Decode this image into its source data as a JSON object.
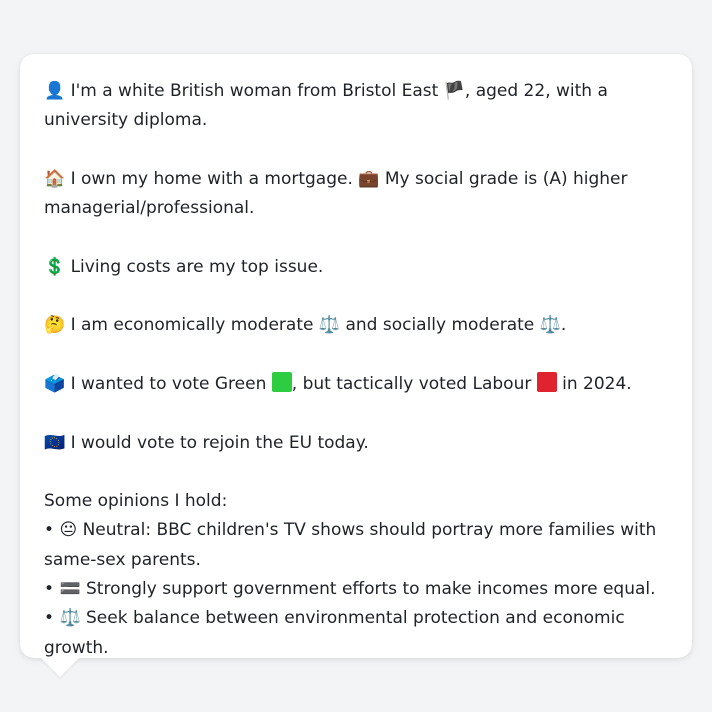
{
  "colors": {
    "background": "#f3f4f6",
    "bubble": "#ffffff",
    "text": "#1f2328",
    "green_square": "#2ecc40",
    "red_square": "#e0242f"
  },
  "persona": {
    "identity": {
      "icon": "👤",
      "text_a": " I'm a white British woman from Bristol East ",
      "flag": "🏴",
      "text_b": ", aged 22, with a university diploma."
    },
    "housing": {
      "icon": "🏠",
      "text_a": " I own my home with a mortgage. ",
      "icon2": "💼",
      "text_b": " My social grade is (A) higher managerial/professional."
    },
    "issue": {
      "icon": "💲",
      "text": " Living costs are my top issue."
    },
    "ideology": {
      "icon": "🤔",
      "text_a": " I am economically moderate ",
      "icon2": "⚖️",
      "text_b": " and socially moderate ",
      "icon3": "⚖️",
      "text_c": "."
    },
    "vote": {
      "icon": "🗳️",
      "text_a": " I wanted to vote Green ",
      "text_b": ", but tactically voted Labour ",
      "text_c": " in 2024."
    },
    "eu": {
      "icon": "🇪🇺",
      "text": " I would vote to rejoin the EU today."
    },
    "opinions": {
      "heading": "Some opinions I hold:",
      "items": [
        {
          "bullet": "•",
          "icon": "😐",
          "text": " Neutral: BBC children's TV shows should portray more families with same-sex parents."
        },
        {
          "bullet": "•",
          "icon": "🟰",
          "text": " Strongly support government efforts to make incomes more equal."
        },
        {
          "bullet": "•",
          "icon": "⚖️",
          "text": " Seek balance between environmental protection and economic growth."
        }
      ]
    }
  }
}
